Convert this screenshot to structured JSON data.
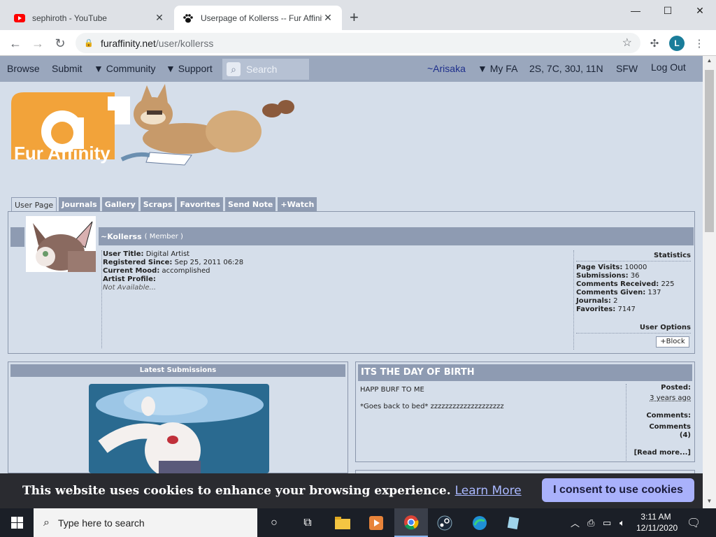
{
  "browser": {
    "tabs": [
      {
        "title": "sephiroth - YouTube",
        "icon": "youtube-icon"
      },
      {
        "title": "Userpage of Kollerss -- Fur Affinity",
        "icon": "paw-icon"
      }
    ],
    "url_host": "furaffinity.net",
    "url_path": "/user/kollerss",
    "profile_initial": "L"
  },
  "site_nav": {
    "browse": "Browse",
    "submit": "Submit",
    "community": "▼ Community",
    "support": "▼ Support",
    "search_placeholder": "Search",
    "username": "~Arisaka",
    "myfa": "▼ My FA",
    "counts": "2S, 7C, 30J, 11N",
    "sfw": "SFW",
    "logout": "Log Out"
  },
  "logo_text": "Fur Affinity",
  "profile_tabs": [
    "User Page",
    "Journals",
    "Gallery",
    "Scraps",
    "Favorites",
    "Send Note",
    "+Watch"
  ],
  "user": {
    "name": "~Kollerss",
    "role": "( Member )",
    "title_label": "User Title:",
    "title_value": "Digital Artist",
    "registered_label": "Registered Since:",
    "registered_value": "Sep 25, 2011 06:28",
    "mood_label": "Current Mood:",
    "mood_value": "accomplished",
    "profile_label": "Artist Profile:",
    "profile_value": "Not Available..."
  },
  "stats": {
    "heading": "Statistics",
    "rows": [
      {
        "label": "Page Visits:",
        "value": "10000"
      },
      {
        "label": "Submissions:",
        "value": "36"
      },
      {
        "label": "Comments Received:",
        "value": "225"
      },
      {
        "label": "Comments Given:",
        "value": "137"
      },
      {
        "label": "Journals:",
        "value": "2"
      },
      {
        "label": "Favorites:",
        "value": "7147"
      }
    ],
    "options_heading": "User Options",
    "block_label": "+Block"
  },
  "latest": {
    "heading": "Latest Submissions"
  },
  "journal": {
    "title": "ITS THE DAY OF BIRTH",
    "line1": "HAPP BURF TO ME",
    "line2": "*Goes back to bed* zzzzzzzzzzzzzzzzzzzz",
    "posted_label": "Posted:",
    "posted_value": "3 years ago",
    "comments_label": "Comments:",
    "comments_link": "Comments",
    "comments_count": "(4)",
    "read_more": "[Read more...]"
  },
  "cookie": {
    "message": "This website uses cookies to enhance your browsing experience.",
    "learn_more": "Learn More",
    "consent": "I consent to use cookies"
  },
  "taskbar": {
    "search_placeholder": "Type here to search",
    "time": "3:11 AM",
    "date": "12/11/2020"
  }
}
